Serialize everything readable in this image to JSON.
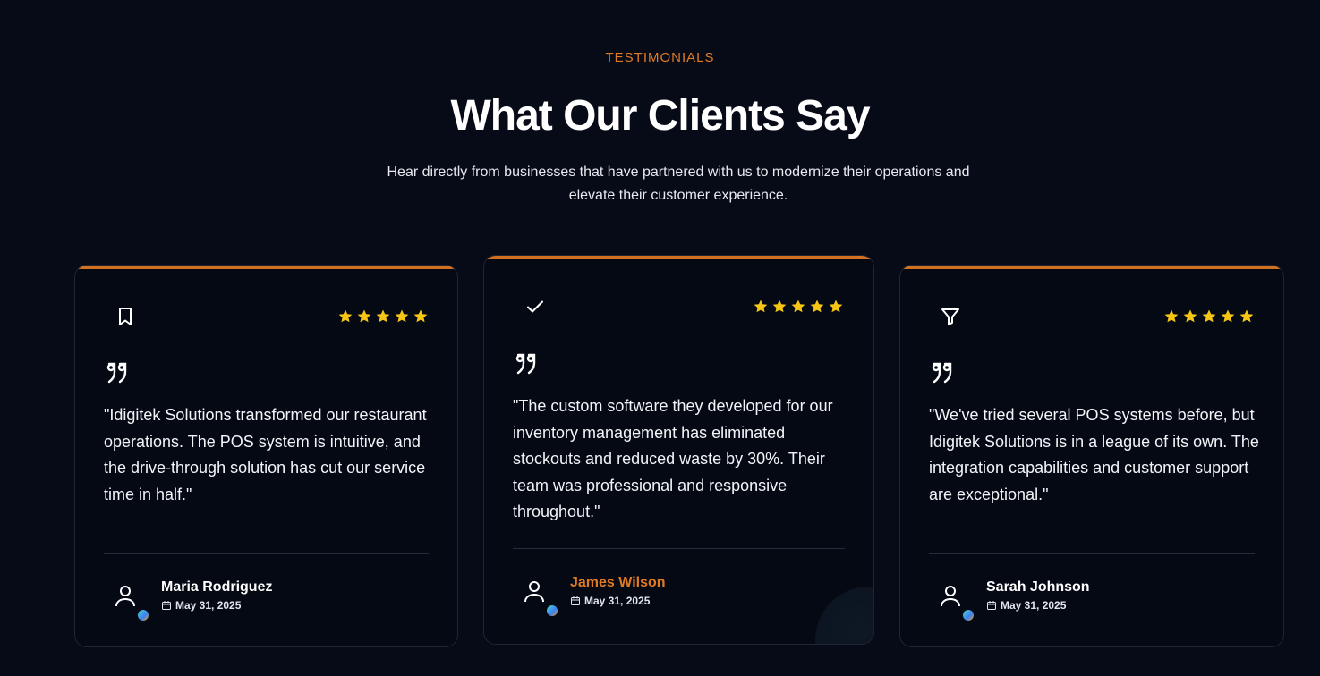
{
  "header": {
    "eyebrow": "TESTIMONIALS",
    "title": "What Our Clients Say",
    "subtitle": "Hear directly from businesses that have partnered with us to modernize their operations and elevate their customer experience."
  },
  "colors": {
    "accent": "#e07b24",
    "background": "#070b17",
    "star": "#f7c515"
  },
  "testimonials": [
    {
      "icon": "bookmark-icon",
      "rating": 5,
      "quote": "\"Idigitek Solutions transformed our restaurant operations. The POS system is intuitive, and the drive-through solution has cut our service time in half.\"",
      "name": "Maria Rodriguez",
      "date": "May 31, 2025"
    },
    {
      "icon": "check-icon",
      "rating": 5,
      "quote": "\"The custom software they developed for our inventory management has eliminated stockouts and reduced waste by 30%. Their team was professional and responsive throughout.\"",
      "name": "James Wilson",
      "date": "May 31, 2025"
    },
    {
      "icon": "filter-icon",
      "rating": 5,
      "quote": "\"We've tried several POS systems before, but Idigitek Solutions is in a league of its own. The integration capabilities and customer support are exceptional.\"",
      "name": "Sarah Johnson",
      "date": "May 31, 2025"
    }
  ]
}
